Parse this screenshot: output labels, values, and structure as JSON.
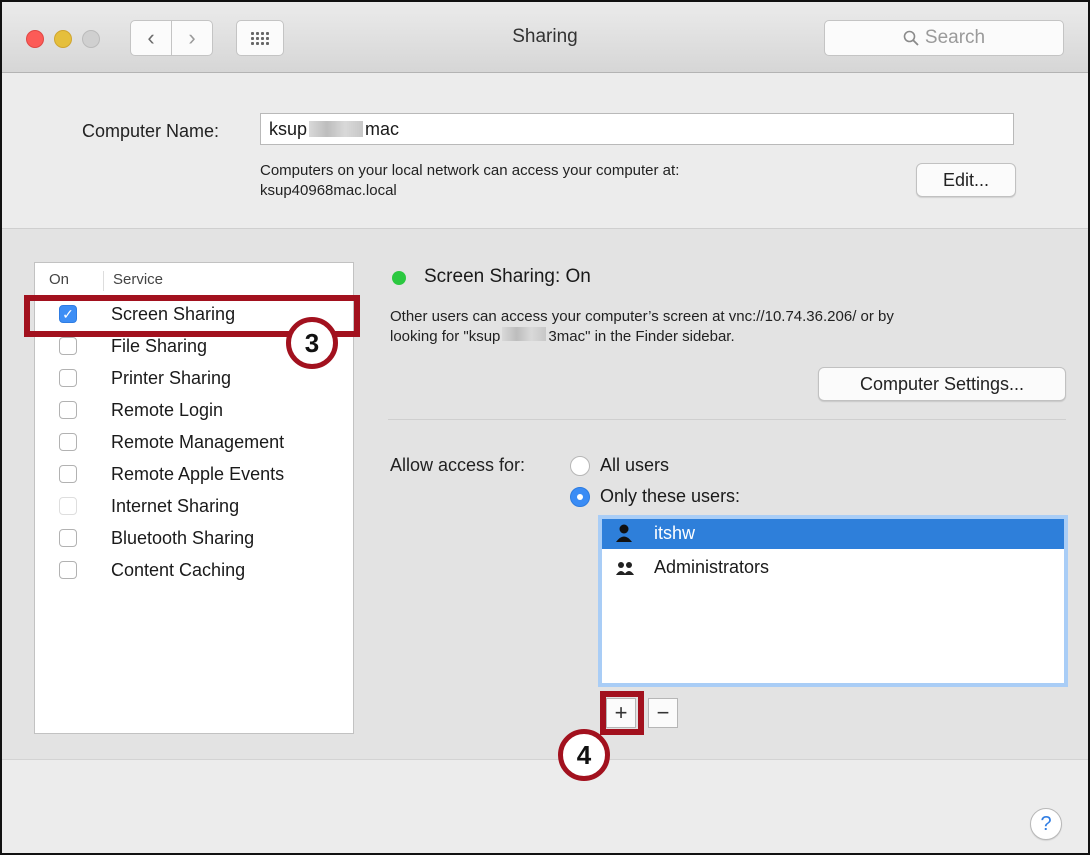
{
  "window": {
    "title": "Sharing"
  },
  "search": {
    "placeholder": "Search",
    "icon": "search-icon"
  },
  "computer_name": {
    "label": "Computer Name:",
    "value_prefix": "ksup",
    "value_suffix": "mac",
    "description_line1": "Computers on your local network can access your computer at:",
    "description_line2": "ksup40968mac.local",
    "edit_button": "Edit..."
  },
  "services": {
    "header_on": "On",
    "header_service": "Service",
    "items": [
      {
        "label": "Screen Sharing",
        "checked": true
      },
      {
        "label": "File Sharing",
        "checked": false
      },
      {
        "label": "Printer Sharing",
        "checked": false
      },
      {
        "label": "Remote Login",
        "checked": false
      },
      {
        "label": "Remote Management",
        "checked": false
      },
      {
        "label": "Remote Apple Events",
        "checked": false
      },
      {
        "label": "Internet Sharing",
        "checked": false,
        "disabled": true
      },
      {
        "label": "Bluetooth Sharing",
        "checked": false
      },
      {
        "label": "Content Caching",
        "checked": false
      }
    ]
  },
  "detail": {
    "status": "Screen Sharing: On",
    "status_color": "#2bc840",
    "description_line1": "Other users can access your computer’s screen at vnc://10.74.36.206/ or by",
    "description_line2_prefix": "looking for \"ksup",
    "description_line2_suffix": "3mac\" in the Finder sidebar.",
    "computer_settings_button": "Computer Settings...",
    "allow_access_label": "Allow access for:",
    "radio_all_users": "All users",
    "radio_only_users": "Only these users:",
    "selected_radio": "only",
    "users": [
      {
        "name": "itshw",
        "icon": "user-icon",
        "selected": true
      },
      {
        "name": "Administrators",
        "icon": "group-icon",
        "selected": false
      }
    ],
    "add_button": "+",
    "remove_button": "−"
  },
  "annotations": {
    "callout_3": "3",
    "callout_4": "4",
    "callout_color": "#a2111e"
  },
  "help_button": "?"
}
